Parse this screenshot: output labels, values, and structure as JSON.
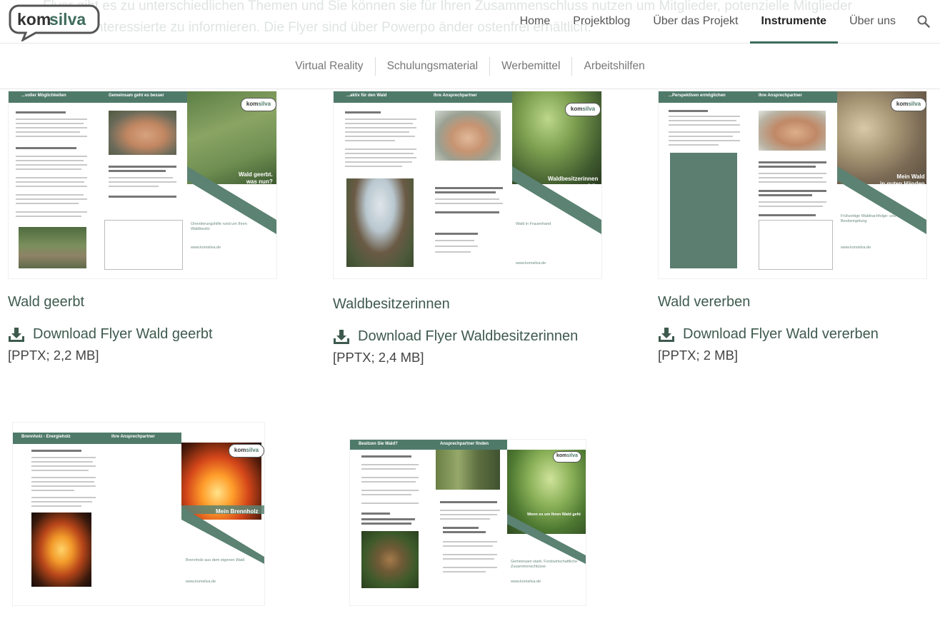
{
  "header": {
    "ghost_lines": [
      "Flyer gibt es zu unterschiedlichen Themen und Sie können sie für Ihren Zusammenschluss nutzen um Mitglieder, potenzielle Mitglieder",
      "ach nur Interessierte zu informieren. Die Flyer sind über Powerpo         änder         ostenfrei erhältlich."
    ],
    "logo_text": "komsilva",
    "nav": [
      "Home",
      "Projektblog",
      "Über das Projekt",
      "Instrumente",
      "Über uns"
    ],
    "active_nav": "Instrumente"
  },
  "subnav": [
    "Virtual Reality",
    "Schulungsmaterial",
    "Werbemittel",
    "Arbeitshilfen"
  ],
  "cards": [
    {
      "title": "Wald geerbt",
      "download": "Download Flyer Wald geerbt",
      "meta": "[PPTX; 2,2 MB]",
      "thumb_left_bar": "...voller Möglichkeiten",
      "thumb_mid_bar": "Gemeinsam  geht es besser",
      "thumb_overlay": "Wald geerbt.\nwas nun?",
      "thumb_footer": "Orientierungshilfe rund um Ihren Waldbesitz",
      "thumb_url": "www.komsilva.de"
    },
    {
      "title": "Waldbesitzerinnen",
      "download": "Download Flyer Waldbesitzerinnen",
      "meta": "[PPTX; 2,4 MB]",
      "thumb_left_bar": "...aktiv für den Wald",
      "thumb_mid_bar": "Ihre Ansprechpartner",
      "thumb_overlay": "Waldbesitzerinnen\naktiv",
      "thumb_footer": "Wald in Frauenhand",
      "thumb_url": "www.komsilva.de"
    },
    {
      "title": "Wald vererben",
      "download": "Download Flyer Wald vererben",
      "meta": "[PPTX; 2 MB]",
      "thumb_left_bar": "...Perspektiven  ermöglichen",
      "thumb_mid_bar": "Ihre Ansprechpartner",
      "thumb_overlay": "Mein Wald\nin guten Händen",
      "thumb_footer": "Frühzeitige Waldnachfolge- und Besitzregelung",
      "thumb_url": "www.komsilva.de"
    },
    {
      "thumb_left_bar": "Brennholz - Energieholz",
      "thumb_mid_bar": "Ihre Ansprechpartner",
      "thumb_overlay": "Mein Brennholz",
      "thumb_footer": "Brennholz aus dem eigenen Wald",
      "thumb_url": "www.komsilva.de"
    },
    {
      "thumb_left_bar": "Besitzen Sie Wald?",
      "thumb_mid_bar": "Ansprechpartner finden",
      "thumb_overlay": "Wenn es um Ihren Wald geht",
      "thumb_footer": "Gemeinsam stark: Forstwirtschaftliche Zusammenschlüsse",
      "thumb_url": "www.komsilva.de"
    }
  ],
  "colors": {
    "accent": "#3e6b5b",
    "title_green": "#3e5a4e",
    "thumb_bar": "#4f7a6a"
  },
  "icons": {
    "search": "search-icon",
    "download": "download-icon"
  }
}
